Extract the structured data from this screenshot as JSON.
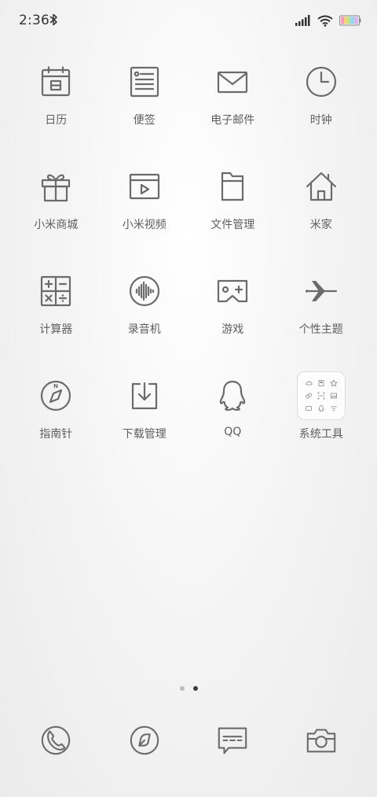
{
  "status_bar": {
    "time": "2:36",
    "icons": [
      "bluetooth-icon",
      "signal-icon",
      "wifi-icon",
      "battery-icon"
    ]
  },
  "apps": [
    {
      "label": "日历",
      "icon": "calendar-icon"
    },
    {
      "label": "便签",
      "icon": "notes-icon"
    },
    {
      "label": "电子邮件",
      "icon": "mail-icon"
    },
    {
      "label": "时钟",
      "icon": "clock-icon"
    },
    {
      "label": "小米商城",
      "icon": "gift-icon"
    },
    {
      "label": "小米视频",
      "icon": "video-icon"
    },
    {
      "label": "文件管理",
      "icon": "folder-icon"
    },
    {
      "label": "米家",
      "icon": "home-icon"
    },
    {
      "label": "计算器",
      "icon": "calculator-icon"
    },
    {
      "label": "录音机",
      "icon": "recorder-icon"
    },
    {
      "label": "游戏",
      "icon": "game-icon"
    },
    {
      "label": "个性主题",
      "icon": "theme-icon"
    },
    {
      "label": "指南针",
      "icon": "compass-icon"
    },
    {
      "label": "下载管理",
      "icon": "download-icon"
    },
    {
      "label": "QQ",
      "icon": "qq-icon"
    },
    {
      "label": "系统工具",
      "icon": "folder-group-icon"
    }
  ],
  "page_indicator": {
    "pages": 2,
    "current": 2
  },
  "dock": [
    {
      "icon": "phone-icon"
    },
    {
      "icon": "browser-icon"
    },
    {
      "icon": "messages-icon"
    },
    {
      "icon": "camera-icon"
    }
  ],
  "colors": {
    "icon_stroke": "#6b6b6b",
    "label": "#5e5e5e",
    "dot_active": "#3a3a3a",
    "dot_inactive": "#bdbdbd"
  }
}
